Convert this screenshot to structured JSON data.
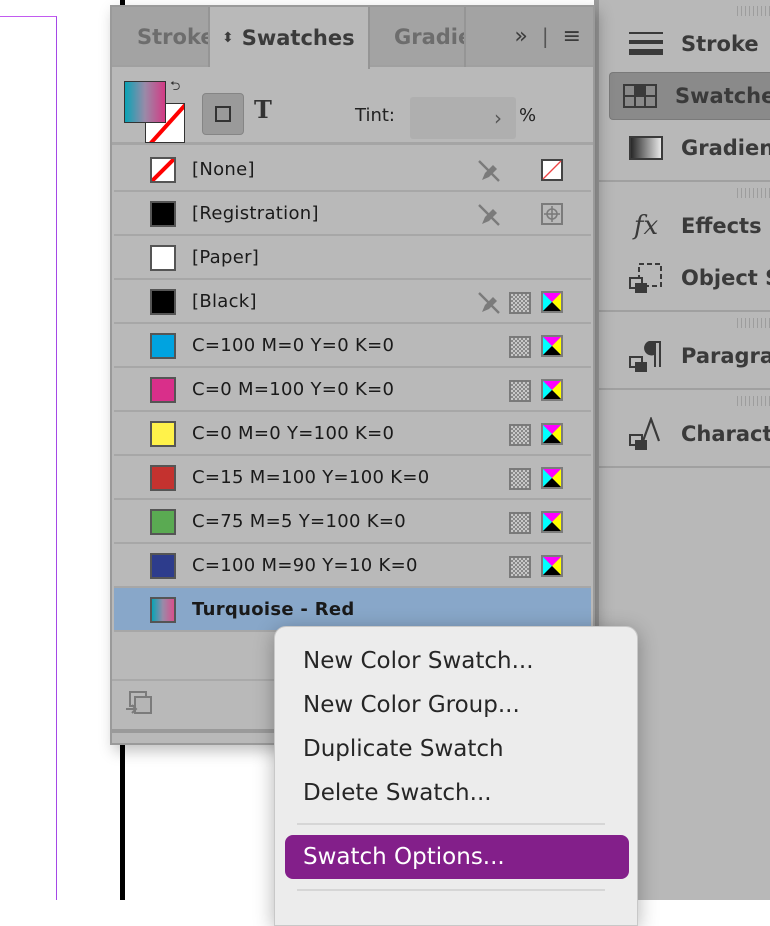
{
  "panel": {
    "tabs": [
      {
        "label": "Stroke"
      },
      {
        "label": "Swatches",
        "active": true
      },
      {
        "label": "Gradie"
      }
    ],
    "overflow_glyph": "»",
    "menu_glyph": "≡",
    "tint": {
      "label": "Tint:",
      "value": "",
      "unit": "%"
    },
    "swatches": [
      {
        "name": "[None]",
        "color": "none",
        "editable": false,
        "mode": "none"
      },
      {
        "name": "[Registration]",
        "color": "#000000",
        "editable": false,
        "mode": "registration"
      },
      {
        "name": "[Paper]",
        "color": "#ffffff",
        "mode": ""
      },
      {
        "name": "[Black]",
        "color": "#000000",
        "editable": false,
        "mode": "cmyk",
        "process": true
      },
      {
        "name": "C=100 M=0 Y=0 K=0",
        "color": "#00a3e0",
        "mode": "cmyk",
        "process": true
      },
      {
        "name": "C=0 M=100 Y=0 K=0",
        "color": "#d92f8a",
        "mode": "cmyk",
        "process": true
      },
      {
        "name": "C=0 M=0 Y=100 K=0",
        "color": "#fff24a",
        "mode": "cmyk",
        "process": true
      },
      {
        "name": "C=15 M=100 Y=100 K=0",
        "color": "#c4322f",
        "mode": "cmyk",
        "process": true
      },
      {
        "name": "C=75 M=5 Y=100 K=0",
        "color": "#5aaa52",
        "mode": "cmyk",
        "process": true
      },
      {
        "name": "C=100 M=90 Y=10 K=0",
        "color": "#2d3c8c",
        "mode": "cmyk",
        "process": true
      },
      {
        "name": "Turquoise - Red",
        "color": "gradient",
        "selected": true
      }
    ]
  },
  "dock": {
    "groups": [
      {
        "items": [
          {
            "label": "Stroke",
            "icon": "stroke-icon"
          },
          {
            "label": "Swatches",
            "icon": "swatches-icon",
            "active": true
          },
          {
            "label": "Gradient",
            "icon": "gradient-icon"
          }
        ]
      },
      {
        "items": [
          {
            "label": "Effects",
            "icon": "fx-icon"
          },
          {
            "label": "Object St",
            "icon": "object-styles-icon"
          }
        ]
      },
      {
        "items": [
          {
            "label": "Paragrap",
            "icon": "paragraph-styles-icon"
          }
        ]
      },
      {
        "items": [
          {
            "label": "Characte",
            "icon": "character-styles-icon"
          }
        ]
      }
    ]
  },
  "context_menu": {
    "items": [
      {
        "label": "New Color Swatch..."
      },
      {
        "label": "New Color Group..."
      },
      {
        "label": "Duplicate Swatch"
      },
      {
        "label": "Delete Swatch..."
      },
      {
        "label": "Swatch Options...",
        "highlighted": true
      }
    ],
    "highlight_color": "#831f8a"
  }
}
